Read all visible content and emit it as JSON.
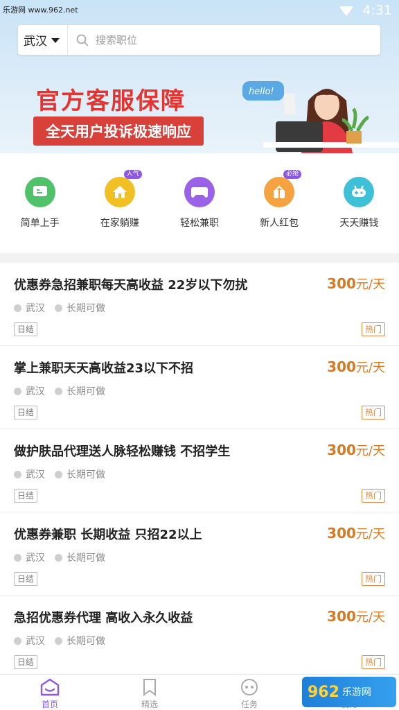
{
  "status_bar": {
    "watermark": "乐游网 www.962.net",
    "time": "4:31"
  },
  "search": {
    "city": "武汉",
    "placeholder": "搜索职位"
  },
  "banner": {
    "title": "官方客服保障",
    "subtitle": "全天用户投诉极速响应",
    "bubble": "hello!"
  },
  "categories": [
    {
      "label": "简单上手",
      "color": "#4fc26a",
      "icon": "chat-icon",
      "badge": ""
    },
    {
      "label": "在家躺赚",
      "color": "#f0c024",
      "icon": "house-icon",
      "badge": "人气"
    },
    {
      "label": "轻松兼职",
      "color": "#9a62e6",
      "icon": "gamepad-icon",
      "badge": ""
    },
    {
      "label": "新人红包",
      "color": "#f4a340",
      "icon": "gift-icon",
      "badge": "必抢"
    },
    {
      "label": "天天赚钱",
      "color": "#3ec0d6",
      "icon": "controller-icon",
      "badge": ""
    }
  ],
  "jobs": [
    {
      "title": "优惠券急招兼职每天高收益 22岁以下勿扰",
      "amount": "300",
      "unit": "元/天",
      "location": "武汉",
      "duration": "长期可做",
      "settle": "日结",
      "tag": "热门"
    },
    {
      "title": "掌上兼职天天高收益23以下不招",
      "amount": "300",
      "unit": "元/天",
      "location": "武汉",
      "duration": "长期可做",
      "settle": "日结",
      "tag": "热门"
    },
    {
      "title": "做护肤品代理送人脉轻松赚钱 不招学生",
      "amount": "300",
      "unit": "元/天",
      "location": "武汉",
      "duration": "长期可做",
      "settle": "日结",
      "tag": "热门"
    },
    {
      "title": "优惠券兼职 长期收益 只招22以上",
      "amount": "300",
      "unit": "元/天",
      "location": "武汉",
      "duration": "长期可做",
      "settle": "日结",
      "tag": "热门"
    },
    {
      "title": "急招优惠券代理 高收入永久收益",
      "amount": "300",
      "unit": "元/天",
      "location": "武汉",
      "duration": "长期可做",
      "settle": "日结",
      "tag": "热门"
    }
  ],
  "bottom_nav": [
    {
      "label": "首页",
      "icon": "home-icon",
      "active": true
    },
    {
      "label": "精选",
      "icon": "bookmark-icon",
      "active": false
    },
    {
      "label": "任务",
      "icon": "task-icon",
      "active": false
    },
    {
      "label": "我的",
      "icon": "user-icon",
      "active": false
    }
  ],
  "corner_watermark": {
    "big": "962",
    "small": "乐游网"
  },
  "colors": {
    "accent": "#8e57e8",
    "salary": "#d97a22",
    "hot": "#e58a45",
    "banner_red": "#e5342f"
  }
}
